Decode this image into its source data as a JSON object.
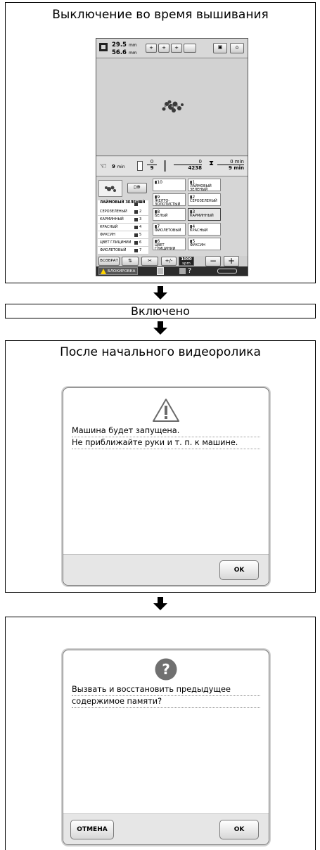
{
  "section1": {
    "title": "Выключение во время вышивания",
    "screen": {
      "size_icon": "hoop-size-icon",
      "width": "29.5",
      "height": "56.6",
      "unit": "mm",
      "status": {
        "time_left": "9",
        "time_left_unit": "min",
        "color_current": "0",
        "color_total": "9",
        "stitch_current": "0",
        "stitch_total": "4238",
        "time_stop": "0",
        "time_stop_unit": "min",
        "time_total": "9",
        "time_total_unit": "min"
      },
      "color_list": [
        {
          "name": "ЛАЙМОВЫЙ ЗЕЛЕНЫЙ",
          "num": "1"
        },
        {
          "name": "СЕРОЗЕЛЕНЫЙ",
          "num": "2"
        },
        {
          "name": "КАРМИННЫЙ",
          "num": "3"
        },
        {
          "name": "КРАСНЫЙ",
          "num": "4"
        },
        {
          "name": "ФУКСИН",
          "num": "5"
        },
        {
          "name": "ЦВЕТ ГЛИЦИНИИ",
          "num": "6"
        },
        {
          "name": "ФИОЛЕТОВЫЙ",
          "num": "7"
        }
      ],
      "spools": [
        {
          "num": "10",
          "name": ""
        },
        {
          "num": "1",
          "name": "ЛАЙМОВЫЙ ЗЕЛЕНЫЙ"
        },
        {
          "num": "9",
          "name": "ЖЕЛТО-ЗОЛОТИСТЫЙ"
        },
        {
          "num": "2",
          "name": "СЕРОЗЕЛЕНЫЙ"
        },
        {
          "num": "8",
          "name": "БЕЛЫЙ"
        },
        {
          "num": "3",
          "name": "КАРМИННЫЙ"
        },
        {
          "num": "7",
          "name": "ФИОЛЕТОВЫЙ"
        },
        {
          "num": "4",
          "name": "КРАСНЫЙ"
        },
        {
          "num": "6",
          "name": "ЦВЕТ ГЛИЦИНИИ"
        },
        {
          "num": "5",
          "name": "ФУКСИН"
        }
      ],
      "return_button": "ВОЗВРАТ",
      "speed": "1000",
      "speed_unit": "spm",
      "lock_label": "БЛОКИРОВКА"
    }
  },
  "section2": {
    "title": "Включено"
  },
  "section3": {
    "title": "После начального видеоролика",
    "dialog": {
      "icon": "warning-icon",
      "line1": "Машина будет запущена.",
      "line2": "Не приближайте руки и т. п. к машине.",
      "ok": "OK"
    }
  },
  "section4": {
    "dialog": {
      "icon": "question-icon",
      "line1": "Вызвать и восстановить предыдущее",
      "line2": "содержимое памяти?",
      "cancel": "ОТМЕНА",
      "ok": "OK"
    }
  }
}
